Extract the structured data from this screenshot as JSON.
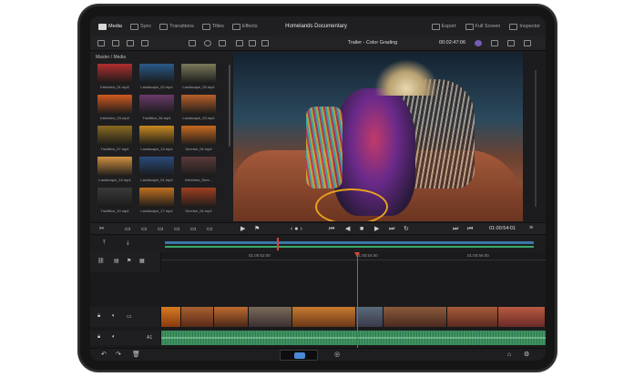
{
  "topbar": {
    "modules": [
      {
        "label": "Media",
        "icon": "media-icon",
        "active": true
      },
      {
        "label": "Sync",
        "icon": "sync-icon",
        "active": false
      },
      {
        "label": "Transitions",
        "icon": "transitions-icon",
        "active": false
      },
      {
        "label": "Titles",
        "icon": "titles-icon",
        "active": false
      },
      {
        "label": "Effects",
        "icon": "effects-icon",
        "active": false
      }
    ],
    "project_title": "Homelands Documentary",
    "right": [
      {
        "label": "Export",
        "icon": "export-icon"
      },
      {
        "label": "Full Screen",
        "icon": "fullscreen-icon"
      },
      {
        "label": "Inspector",
        "icon": "inspector-icon"
      }
    ]
  },
  "viewer": {
    "title": "Trailer - Color Grading",
    "timecode": "00:02:47:06"
  },
  "media": {
    "breadcrumb": "Master / Media",
    "clips": [
      {
        "name": "Interview_01.mp4",
        "color": "#b03030"
      },
      {
        "name": "Landscape_02.mp4",
        "color": "#2a5a8a"
      },
      {
        "name": "Landscape_05.mp4",
        "color": "#7a7a5a"
      },
      {
        "name": "Interview_03.mp4",
        "color": "#d05a20"
      },
      {
        "name": "Tradition_06.mp4",
        "color": "#6a3a6a"
      },
      {
        "name": "Landscape_03.mp4",
        "color": "#b8602a"
      },
      {
        "name": "Tradition_07.mp4",
        "color": "#8a6a20"
      },
      {
        "name": "Landscape_13.mp4",
        "color": "#c88a20"
      },
      {
        "name": "Sunrise_04.mp4",
        "color": "#c86a20"
      },
      {
        "name": "Landscape_24.mp4",
        "color": "#d09040"
      },
      {
        "name": "Landscape_01.mp4",
        "color": "#2a4a7a"
      },
      {
        "name": "Interview_Sunr...",
        "color": "#5a3a3a"
      },
      {
        "name": "Tradition_10.mp4",
        "color": "#3a3a3a"
      },
      {
        "name": "Landscape_17.mp4",
        "color": "#c07020"
      },
      {
        "name": "Sunrise_04.mp4",
        "color": "#a04020"
      }
    ]
  },
  "transport": {
    "timecode": "01:00:54:01"
  },
  "timeline": {
    "ruler": [
      "01:00:52:00",
      "01:00:54:00",
      "01:00:56:00"
    ],
    "audio_track_label": "A1"
  },
  "colors": {
    "accent_red": "#e0433a",
    "audio_green": "#3c8c62",
    "bg": "#1c1c1e"
  }
}
